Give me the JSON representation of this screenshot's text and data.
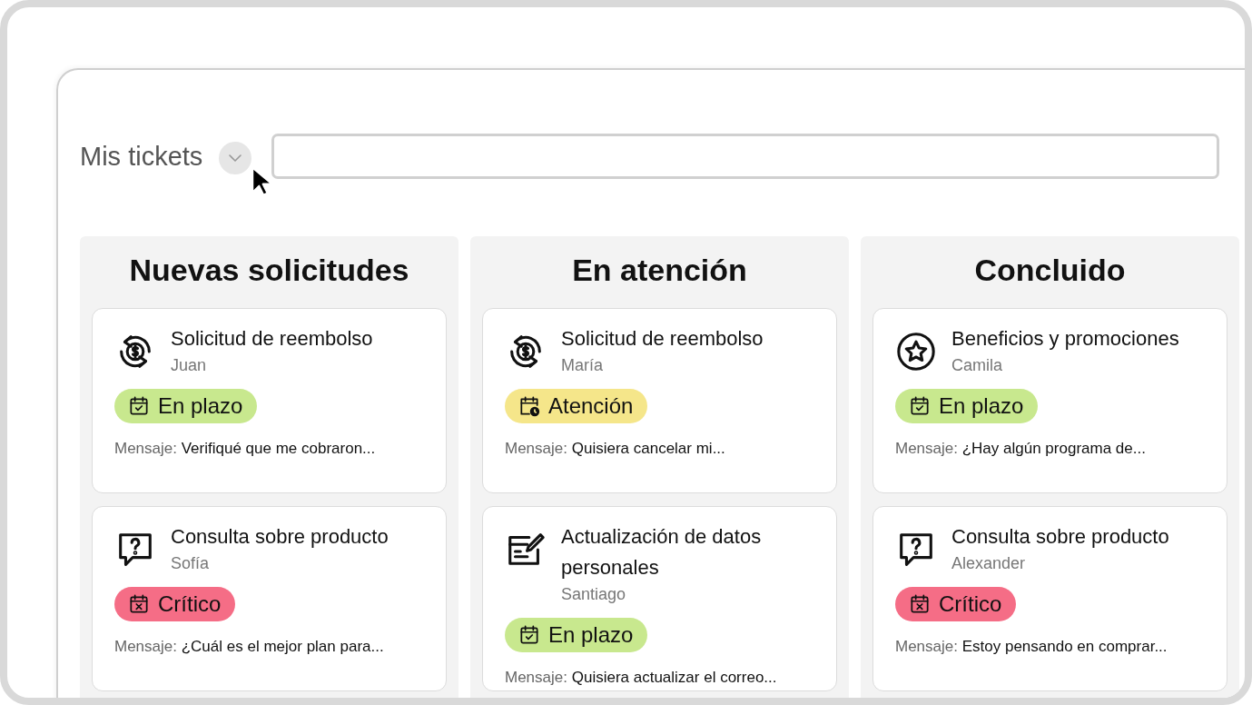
{
  "header": {
    "title": "Mis tickets"
  },
  "columns": [
    {
      "title": "Nuevas solicitudes",
      "tickets": [
        {
          "kind": "refund",
          "title": "Solicitud de reembolso",
          "customer": "Juan",
          "status": {
            "kind": "on_time",
            "label": "En plazo"
          },
          "message_label": "Mensaje:",
          "message": "Verifiqué que me cobraron..."
        },
        {
          "kind": "question",
          "title": "Consulta sobre producto",
          "customer": "Sofía",
          "status": {
            "kind": "critical",
            "label": "Crítico"
          },
          "message_label": "Mensaje:",
          "message": "¿Cuál es el mejor plan para..."
        }
      ]
    },
    {
      "title": "En atención",
      "tickets": [
        {
          "kind": "refund",
          "title": "Solicitud de reembolso",
          "customer": "María",
          "status": {
            "kind": "attention",
            "label": "Atención"
          },
          "message_label": "Mensaje:",
          "message": "Quisiera cancelar mi..."
        },
        {
          "kind": "form",
          "title": "Actualización de datos personales",
          "customer": "Santiago",
          "status": {
            "kind": "on_time",
            "label": "En plazo"
          },
          "message_label": "Mensaje:",
          "message": "Quisiera actualizar el correo..."
        }
      ]
    },
    {
      "title": "Concluido",
      "tickets": [
        {
          "kind": "star",
          "title": "Beneficios y promociones",
          "customer": "Camila",
          "status": {
            "kind": "on_time",
            "label": "En plazo"
          },
          "message_label": "Mensaje:",
          "message": "¿Hay algún programa de..."
        },
        {
          "kind": "question",
          "title": "Consulta sobre producto",
          "customer": "Alexander",
          "status": {
            "kind": "critical",
            "label": "Crítico"
          },
          "message_label": "Mensaje:",
          "message": "Estoy pensando en comprar..."
        }
      ]
    }
  ]
}
